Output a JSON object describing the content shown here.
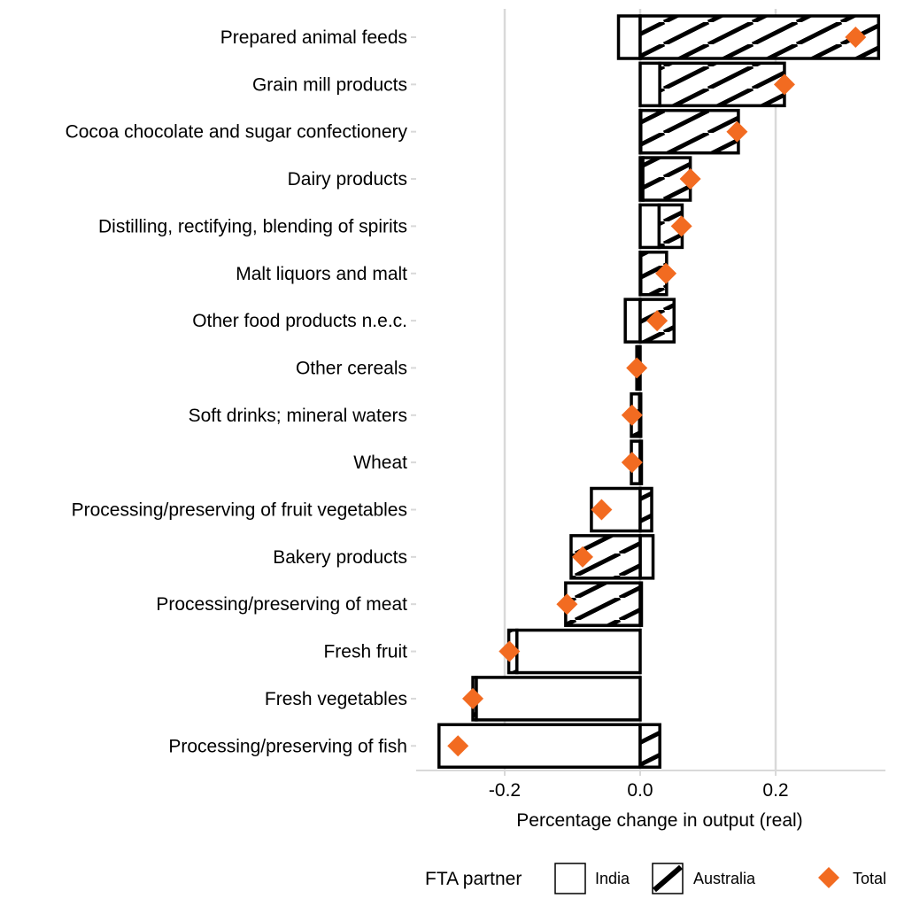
{
  "chart_data": {
    "type": "bar",
    "orientation": "horizontal",
    "stacked": true,
    "title": "",
    "xlabel": "Percentage change in output (real)",
    "ylabel": "",
    "xlim": [
      -0.33,
      0.36
    ],
    "xticks": [
      -0.2,
      0.0,
      0.2
    ],
    "xtick_labels": [
      "-0.2",
      "0.0",
      "0.2"
    ],
    "grid": "vertical-major",
    "categories": [
      "Prepared animal feeds",
      "Grain mill products",
      "Cocoa chocolate and sugar confectionery",
      "Dairy products",
      "Distilling, rectifying, blending of spirits",
      "Malt liquors and malt",
      "Other food products n.e.c.",
      "Other cereals",
      "Soft drinks; mineral waters",
      "Wheat",
      "Processing/preserving of fruit  vegetables",
      "Bakery products",
      "Processing/preserving of meat",
      "Fresh fruit",
      "Fresh vegetables",
      "Processing/preserving of fish"
    ],
    "series": [
      {
        "name": "India",
        "fill": "white",
        "values": [
          -0.032,
          0.029,
          0.001,
          0.004,
          0.028,
          0.001,
          -0.022,
          -0.003,
          -0.001,
          -0.013,
          -0.072,
          0.019,
          0.001,
          -0.182,
          -0.242,
          -0.297
        ]
      },
      {
        "name": "Australia",
        "fill": "hatched",
        "values": [
          0.352,
          0.184,
          0.144,
          0.07,
          0.034,
          0.038,
          0.05,
          -0.002,
          -0.012,
          0.001,
          0.017,
          -0.102,
          -0.11,
          -0.012,
          -0.005,
          0.029
        ]
      }
    ],
    "total": {
      "name": "Total",
      "marker": "diamond",
      "color": "#F26B21",
      "values": [
        0.318,
        0.213,
        0.143,
        0.074,
        0.061,
        0.038,
        0.025,
        -0.005,
        -0.012,
        -0.012,
        -0.057,
        -0.085,
        -0.108,
        -0.193,
        -0.247,
        -0.269
      ]
    },
    "legend": {
      "title": "FTA  partner",
      "position": "bottom",
      "items": [
        "India",
        "Australia",
        "Total"
      ]
    }
  }
}
